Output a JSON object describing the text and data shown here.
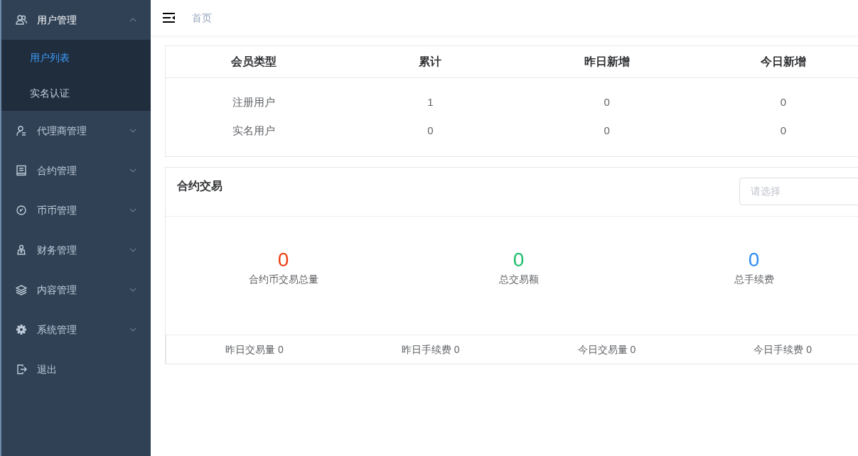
{
  "sidebar": {
    "items": [
      {
        "label": "用户管理",
        "expanded": true,
        "children": [
          {
            "label": "用户列表",
            "selected": true
          },
          {
            "label": "实名认证",
            "selected": false
          }
        ]
      },
      {
        "label": "代理商管理",
        "expanded": false
      },
      {
        "label": "合约管理",
        "expanded": false
      },
      {
        "label": "币币管理",
        "expanded": false
      },
      {
        "label": "财务管理",
        "expanded": false
      },
      {
        "label": "内容管理",
        "expanded": false
      },
      {
        "label": "系统管理",
        "expanded": false
      },
      {
        "label": "退出"
      }
    ]
  },
  "breadcrumb": "首页",
  "member_table": {
    "columns": [
      "会员类型",
      "累计",
      "昨日新增",
      "今日新增"
    ],
    "rows": [
      [
        "注册用户",
        "1",
        "0",
        "0"
      ],
      [
        "实名用户",
        "0",
        "0",
        "0"
      ]
    ]
  },
  "contract_panel": {
    "title": "合约交易",
    "select": {
      "placeholder": "请选择"
    },
    "stats": [
      {
        "value": "0",
        "label": "合约币交易总量",
        "color": "#ed4014"
      },
      {
        "value": "0",
        "label": "总交易额",
        "color": "#19be6b"
      },
      {
        "value": "0",
        "label": "总手续费",
        "color": "#2d8cf0"
      }
    ],
    "footer": [
      "昨日交易量 0",
      "昨日手续费 0",
      "今日交易量 0",
      "今日手续费 0"
    ]
  }
}
